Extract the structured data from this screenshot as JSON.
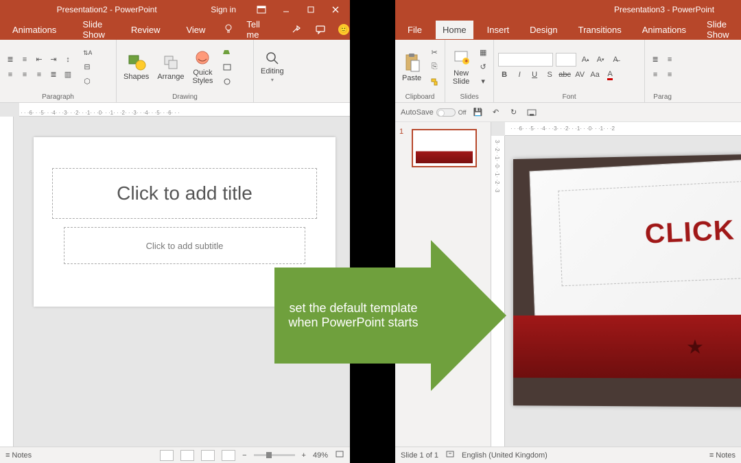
{
  "left": {
    "title": "Presentation2  -  PowerPoint",
    "signin": "Sign in",
    "tabs": {
      "animations": "Animations",
      "slideshow": "Slide Show",
      "review": "Review",
      "view": "View",
      "tellme": "Tell me"
    },
    "groups": {
      "paragraph": "Paragraph",
      "drawing": "Drawing",
      "editing": "Editing"
    },
    "buttons": {
      "shapes": "Shapes",
      "arrange": "Arrange",
      "quickstyles": "Quick\nStyles",
      "editing": "Editing"
    },
    "slide": {
      "title": "Click to add title",
      "subtitle": "Click to add subtitle"
    },
    "status": {
      "notes": "Notes",
      "zoom": "49%"
    }
  },
  "right": {
    "title": "Presentation3  -  PowerPoint",
    "tabs": {
      "file": "File",
      "home": "Home",
      "insert": "Insert",
      "design": "Design",
      "transitions": "Transitions",
      "animations": "Animations",
      "slideshow": "Slide Show"
    },
    "groups": {
      "clipboard": "Clipboard",
      "slides": "Slides",
      "font": "Font",
      "paragraph": "Parag"
    },
    "buttons": {
      "paste": "Paste",
      "newslide": "New\nSlide"
    },
    "qat": {
      "autosave": "AutoSave",
      "off": "Off"
    },
    "thumb": {
      "num": "1"
    },
    "slide": {
      "headline": "CLICK T"
    },
    "status": {
      "slidecount": "Slide 1 of 1",
      "lang": "English (United Kingdom)",
      "notes": "Notes"
    }
  },
  "arrow": {
    "line1": "set the default template",
    "line2": "when PowerPoint starts"
  },
  "ruler_marks": [
    "6",
    "5",
    "4",
    "3",
    "2",
    "1",
    "0",
    "1",
    "2",
    "3",
    "4",
    "5",
    "6"
  ]
}
